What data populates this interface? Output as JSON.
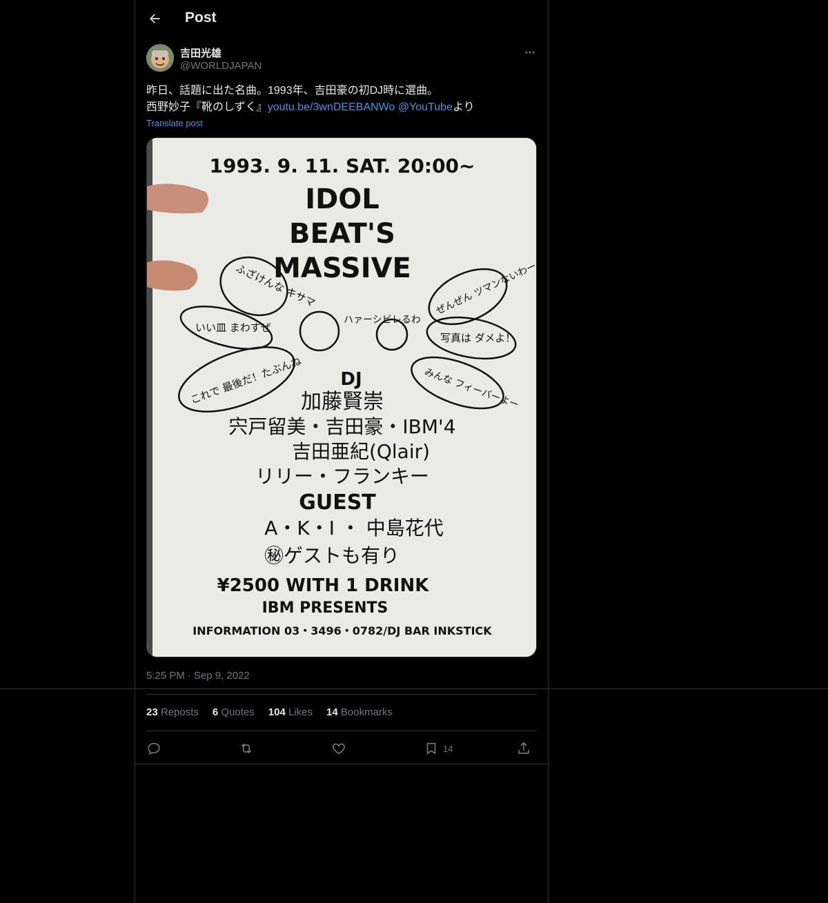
{
  "header": {
    "title": "Post",
    "back_icon": "arrow-left-icon"
  },
  "author": {
    "name": "吉田光雄",
    "handle": "@WORLDJAPAN"
  },
  "post": {
    "line1": "昨日、話題に出た名曲。1993年、吉田豪の初DJ時に選曲。",
    "line2_prefix": "西野妙子『靴のしずく』",
    "link": "youtu.be/3wnDEEBANWo",
    "mention": "@YouTube",
    "line2_suffix": "より",
    "translate": "Translate post"
  },
  "flyer": {
    "date": "1993. 9. 11. SAT. 20:00~",
    "title1": "IDOL",
    "title2": "BEAT'S",
    "title3": "MASSIVE",
    "bubble_left1": "ふざけんな キサマ",
    "bubble_left2": "いい皿 まわすぜ",
    "bubble_left3": "これで 最後だ！たぶんね",
    "bubble_center": "ハァーシビレるわ",
    "bubble_right1": "ぜんぜん ツマンないわー",
    "bubble_right2": "写真は ダメよ！",
    "bubble_right3": "みんな フィーバーよー",
    "dj_label": "DJ",
    "dj1": "加藤賢崇",
    "dj2": "宍戸留美・吉田豪・IBM'4",
    "dj3": "吉田亜紀(Qlair)",
    "dj4": "リリー・フランキー",
    "guest_label": "GUEST",
    "guest1": "A・K・I ・ 中島花代",
    "guest2": "㊙ゲストも有り",
    "price": "¥2500  WITH  1 DRINK",
    "presents": "IBM  PRESENTS",
    "info": "INFORMATION 03・3496・0782/DJ BAR INKSTICK"
  },
  "meta": {
    "time": "5:25 PM",
    "sep": "·",
    "date": "Sep 9, 2022"
  },
  "stats": {
    "reposts_count": "23",
    "reposts_label": "Reposts",
    "quotes_count": "6",
    "quotes_label": "Quotes",
    "likes_count": "104",
    "likes_label": "Likes",
    "bookmarks_count": "14",
    "bookmarks_label": "Bookmarks"
  },
  "actions": {
    "bookmark_count": "14"
  },
  "icons": [
    "arrow-left-icon",
    "more-icon",
    "reply-icon",
    "repost-icon",
    "like-icon",
    "bookmark-icon",
    "share-icon"
  ]
}
